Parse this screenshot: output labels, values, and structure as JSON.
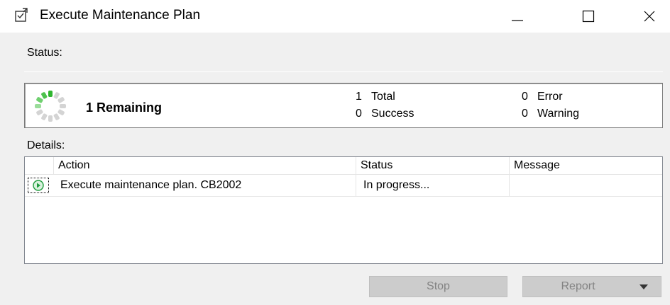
{
  "window": {
    "title": "Execute Maintenance Plan",
    "icon": "maintenance-plan-icon",
    "controls": [
      "minimize-icon",
      "maximize-icon",
      "close-icon"
    ]
  },
  "status_section": {
    "label": "Status:",
    "remaining": "1  Remaining",
    "total_count": "1",
    "total_label": "Total",
    "success_count": "0",
    "success_label": "Success",
    "error_count": "0",
    "error_label": "Error",
    "warning_count": "0",
    "warning_label": "Warning"
  },
  "details_section": {
    "label": "Details:",
    "columns": [
      "Action",
      "Status",
      "Message"
    ],
    "rows": [
      {
        "icon": "play-circle-icon",
        "action": "Execute maintenance plan. CB2002",
        "status": "In progress...",
        "message": ""
      }
    ]
  },
  "buttons": {
    "stop": "Stop",
    "report": "Report"
  },
  "colors": {
    "spinner_active": "#2fb52f",
    "spinner_inactive": "#d4d4d4",
    "disabled_button": "#cccccc",
    "row_icon": "#1e9b3c"
  }
}
